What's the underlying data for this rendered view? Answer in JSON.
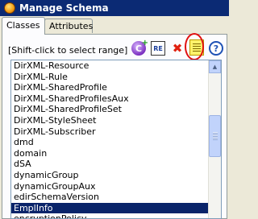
{
  "window": {
    "title": "Manage Schema",
    "icon": "novell-logo-icon"
  },
  "tabs": [
    {
      "label": "Classes",
      "active": true
    },
    {
      "label": "Attributes",
      "active": false
    }
  ],
  "toolbar": {
    "hint": "[Shift-click to select range]",
    "re_label": "RE",
    "help_label": "?",
    "delete_glyph": "✖",
    "add_plus": "+",
    "buttons": [
      "add-class-icon",
      "re-icon",
      "delete-icon",
      "notes-icon",
      "help-icon"
    ]
  },
  "list": {
    "items": [
      "DirXML-Resource",
      "DirXML-Rule",
      "DirXML-SharedProfile",
      "DirXML-SharedProfilesAux",
      "DirXML-SharedProfileSet",
      "DirXML-StyleSheet",
      "DirXML-Subscriber",
      "dmd",
      "domain",
      "dSA",
      "dynamicGroup",
      "dynamicGroupAux",
      "edirSchemaVersion",
      "EmplInfo",
      "encryptionPolicy"
    ],
    "selected": "EmplInfo"
  },
  "scrollbar": {
    "up_arrow": "▲"
  },
  "colors": {
    "title_bar": "#0b2a74",
    "selection": "#0a246a",
    "highlight_circle": "#e01010"
  }
}
